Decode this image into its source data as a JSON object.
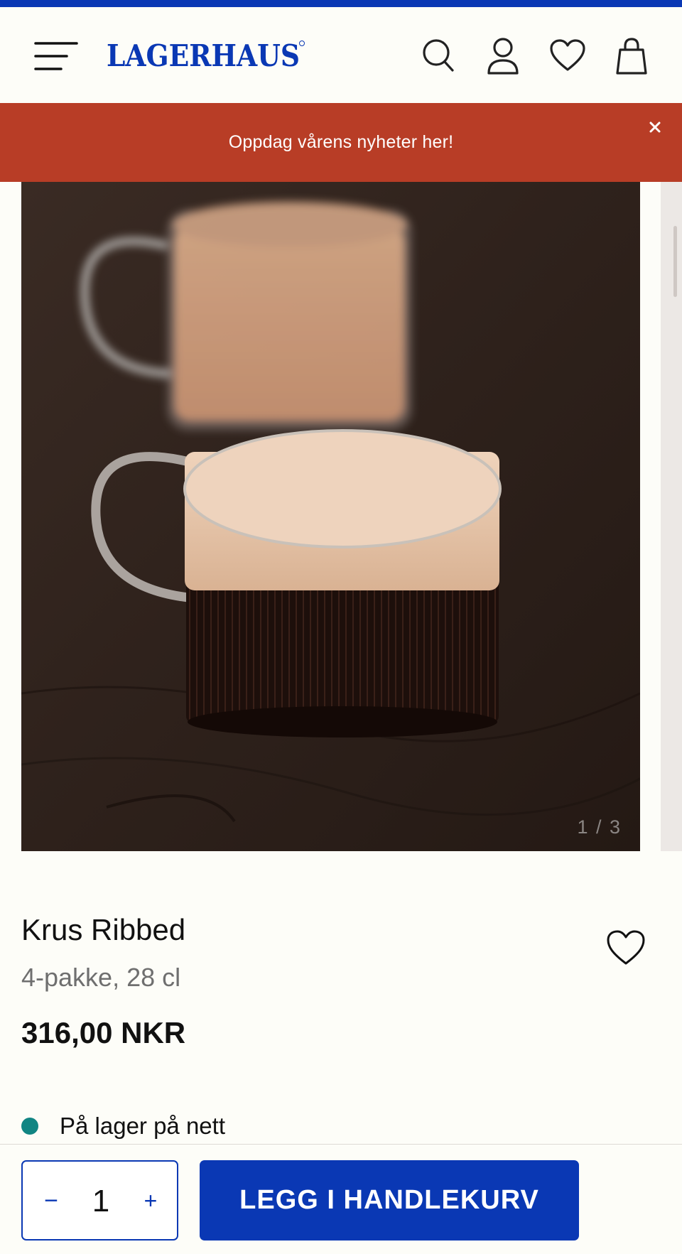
{
  "header": {
    "brand": "LAGERHAUS",
    "icons": [
      "menu-icon",
      "search-icon",
      "account-icon",
      "wishlist-icon",
      "bag-icon"
    ]
  },
  "promo": {
    "text": "Oppdag vårens nyheter her!",
    "close_icon": "close-icon"
  },
  "gallery": {
    "counter": "1 / 3",
    "current": 1,
    "total": 3
  },
  "product": {
    "title": "Krus Ribbed",
    "subtitle": "4-pakke, 28 cl",
    "price": "316,00 NKR",
    "stock_text": "På lager på nett"
  },
  "cart": {
    "minus_label": "−",
    "quantity": "1",
    "plus_label": "+",
    "add_label": "LEGG I HANDLEKURV"
  },
  "colors": {
    "brand_blue": "#0a38b4",
    "promo_red": "#b83d26",
    "stock_green": "#118583",
    "background": "#fdfdf8"
  }
}
